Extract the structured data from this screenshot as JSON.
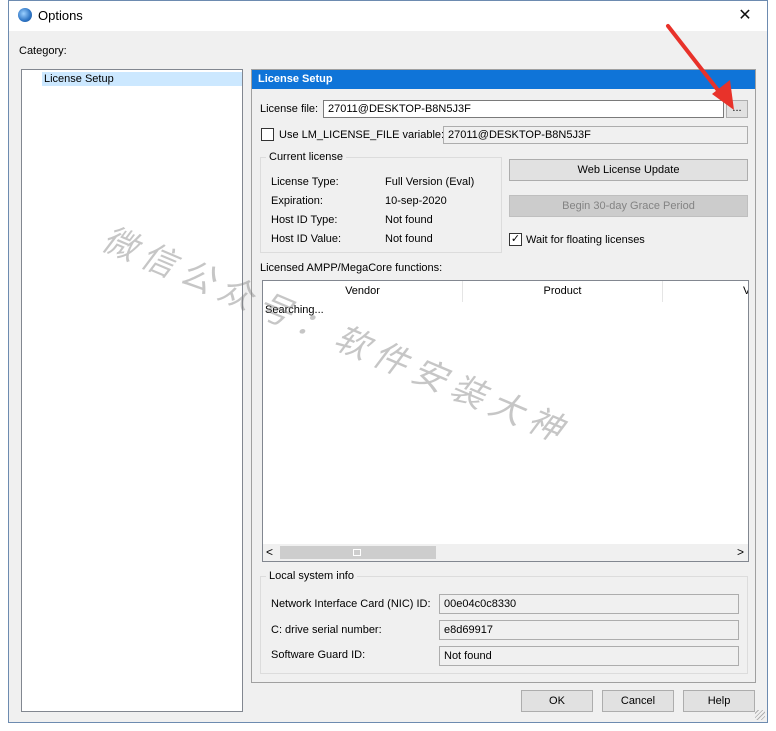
{
  "window": {
    "title": "Options",
    "close_glyph": "✕"
  },
  "category": {
    "label": "Category:",
    "items": [
      {
        "label": "License Setup",
        "selected": true
      }
    ]
  },
  "license_setup": {
    "header": "License Setup",
    "license_file_label": "License file:",
    "license_file_value": "27011@DESKTOP-B8N5J3F",
    "browse_label": "...",
    "use_lm_license": {
      "label": "Use LM_LICENSE_FILE variable:",
      "checked": false,
      "value": "27011@DESKTOP-B8N5J3F"
    },
    "current_license": {
      "title": "Current license",
      "rows": [
        {
          "label": "License Type:",
          "value": "Full Version (Eval)"
        },
        {
          "label": "Expiration:",
          "value": "10-sep-2020"
        },
        {
          "label": "Host ID Type:",
          "value": "Not found"
        },
        {
          "label": "Host ID Value:",
          "value": "Not found"
        }
      ]
    },
    "web_license_update_label": "Web License Update",
    "grace_period_label": "Begin 30-day Grace Period",
    "wait_floating": {
      "label": "Wait for floating licenses",
      "checked": true,
      "check_glyph": "✓"
    },
    "functions_label": "Licensed AMPP/MegaCore functions:",
    "functions_table": {
      "columns": [
        "Vendor",
        "Product",
        "V"
      ],
      "status_text": "Searching..."
    },
    "scroll": {
      "left_glyph": "<",
      "right_glyph": ">"
    },
    "local_info": {
      "title": "Local system info",
      "rows": [
        {
          "label": "Network Interface Card (NIC) ID:",
          "value": "00e04c0c8330"
        },
        {
          "label": "C: drive serial number:",
          "value": "e8d69917"
        },
        {
          "label": "Software Guard ID:",
          "value": "Not found"
        }
      ]
    }
  },
  "footer": {
    "ok_label": "OK",
    "cancel_label": "Cancel",
    "help_label": "Help"
  },
  "watermark": {
    "text": "微信公众号：软件安装大神"
  },
  "colors": {
    "header_blue": "#0f74d8",
    "selection": "#cce8ff",
    "arrow_red": "#e8322a"
  }
}
